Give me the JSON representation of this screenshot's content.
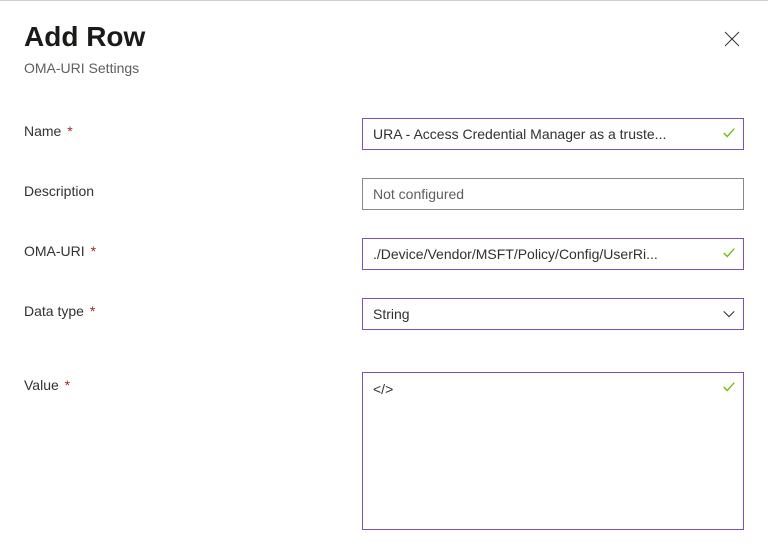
{
  "header": {
    "title": "Add Row",
    "subtitle": "OMA-URI Settings"
  },
  "fields": {
    "name": {
      "label": "Name",
      "required": "*",
      "value": "URA - Access Credential Manager as a truste..."
    },
    "description": {
      "label": "Description",
      "placeholder": "Not configured",
      "value": ""
    },
    "oma_uri": {
      "label": "OMA-URI",
      "required": "*",
      "value": "./Device/Vendor/MSFT/Policy/Config/UserRi..."
    },
    "data_type": {
      "label": "Data type",
      "required": "*",
      "selected": "String"
    },
    "value": {
      "label": "Value",
      "required": "*",
      "text": "</>"
    }
  },
  "colors": {
    "accent": "#7e4fb5",
    "check": "#6bb700",
    "required": "#a4262c"
  }
}
